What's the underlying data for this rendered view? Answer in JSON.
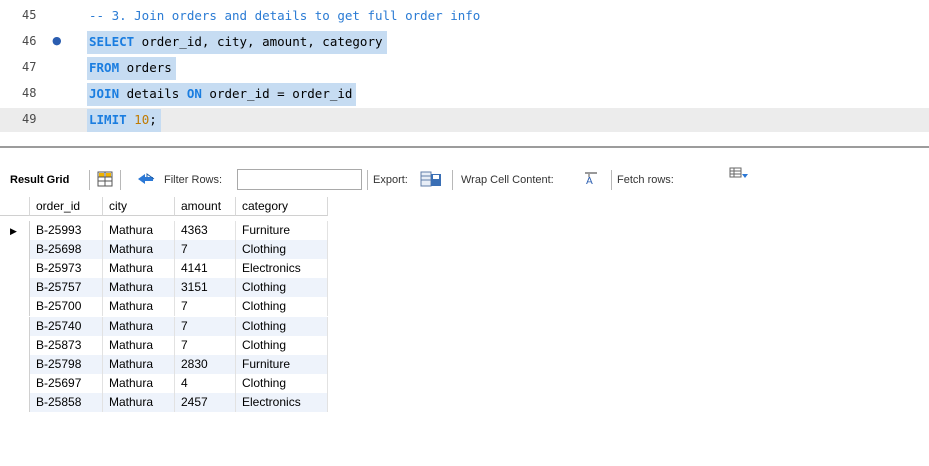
{
  "editor": {
    "lines": [
      {
        "num": "45",
        "parts": [
          {
            "t": "-- 3. Join orders and details to get full order info",
            "k": "cm"
          }
        ],
        "selected": false
      },
      {
        "num": "46",
        "marker": "●",
        "parts": [
          {
            "t": "SELECT",
            "k": "kw"
          },
          {
            "t": " order_id, city, amount, category",
            "k": ""
          }
        ],
        "selected": true
      },
      {
        "num": "47",
        "parts": [
          {
            "t": "FROM",
            "k": "kw"
          },
          {
            "t": " orders",
            "k": ""
          }
        ],
        "selected": true
      },
      {
        "num": "48",
        "parts": [
          {
            "t": "JOIN",
            "k": "kw"
          },
          {
            "t": " details ",
            "k": ""
          },
          {
            "t": "ON",
            "k": "kw"
          },
          {
            "t": " order_id = order_id",
            "k": ""
          }
        ],
        "selected": true
      },
      {
        "num": "49",
        "parts": [
          {
            "t": "LIMIT",
            "k": "kw"
          },
          {
            "t": " ",
            "k": ""
          },
          {
            "t": "10",
            "k": "num"
          },
          {
            "t": ";",
            "k": ""
          }
        ],
        "selected": true,
        "current": true
      }
    ]
  },
  "toolbar": {
    "result_grid": "Result Grid",
    "filter_rows": "Filter Rows:",
    "filter_value": "",
    "export": "Export:",
    "wrap": "Wrap Cell Content:",
    "fetch": "Fetch rows:"
  },
  "icons": {
    "grid": "grid-icon",
    "refresh": "refresh-arrows-icon",
    "export": "export-icon",
    "wrap": "wrap-text-icon",
    "fetch": "fetch-rows-icon",
    "row_pointer": "row-pointer-icon"
  },
  "grid": {
    "columns": [
      "order_id",
      "city",
      "amount",
      "category"
    ],
    "rows": [
      [
        "B-25993",
        "Mathura",
        "4363",
        "Furniture"
      ],
      [
        "B-25698",
        "Mathura",
        "7",
        "Clothing"
      ],
      [
        "B-25973",
        "Mathura",
        "4141",
        "Electronics"
      ],
      [
        "B-25757",
        "Mathura",
        "3151",
        "Clothing"
      ],
      [
        "B-25700",
        "Mathura",
        "7",
        "Clothing"
      ],
      [
        "B-25740",
        "Mathura",
        "7",
        "Clothing"
      ],
      [
        "B-25873",
        "Mathura",
        "7",
        "Clothing"
      ],
      [
        "B-25798",
        "Mathura",
        "2830",
        "Furniture"
      ],
      [
        "B-25697",
        "Mathura",
        "4",
        "Clothing"
      ],
      [
        "B-25858",
        "Mathura",
        "2457",
        "Electronics"
      ]
    ],
    "pointer_row": 0,
    "pointer": "▶"
  },
  "colors": {
    "keyword": "#1a7de0",
    "selection": "#c6dcf2",
    "row_alt": "#eef3fb"
  }
}
